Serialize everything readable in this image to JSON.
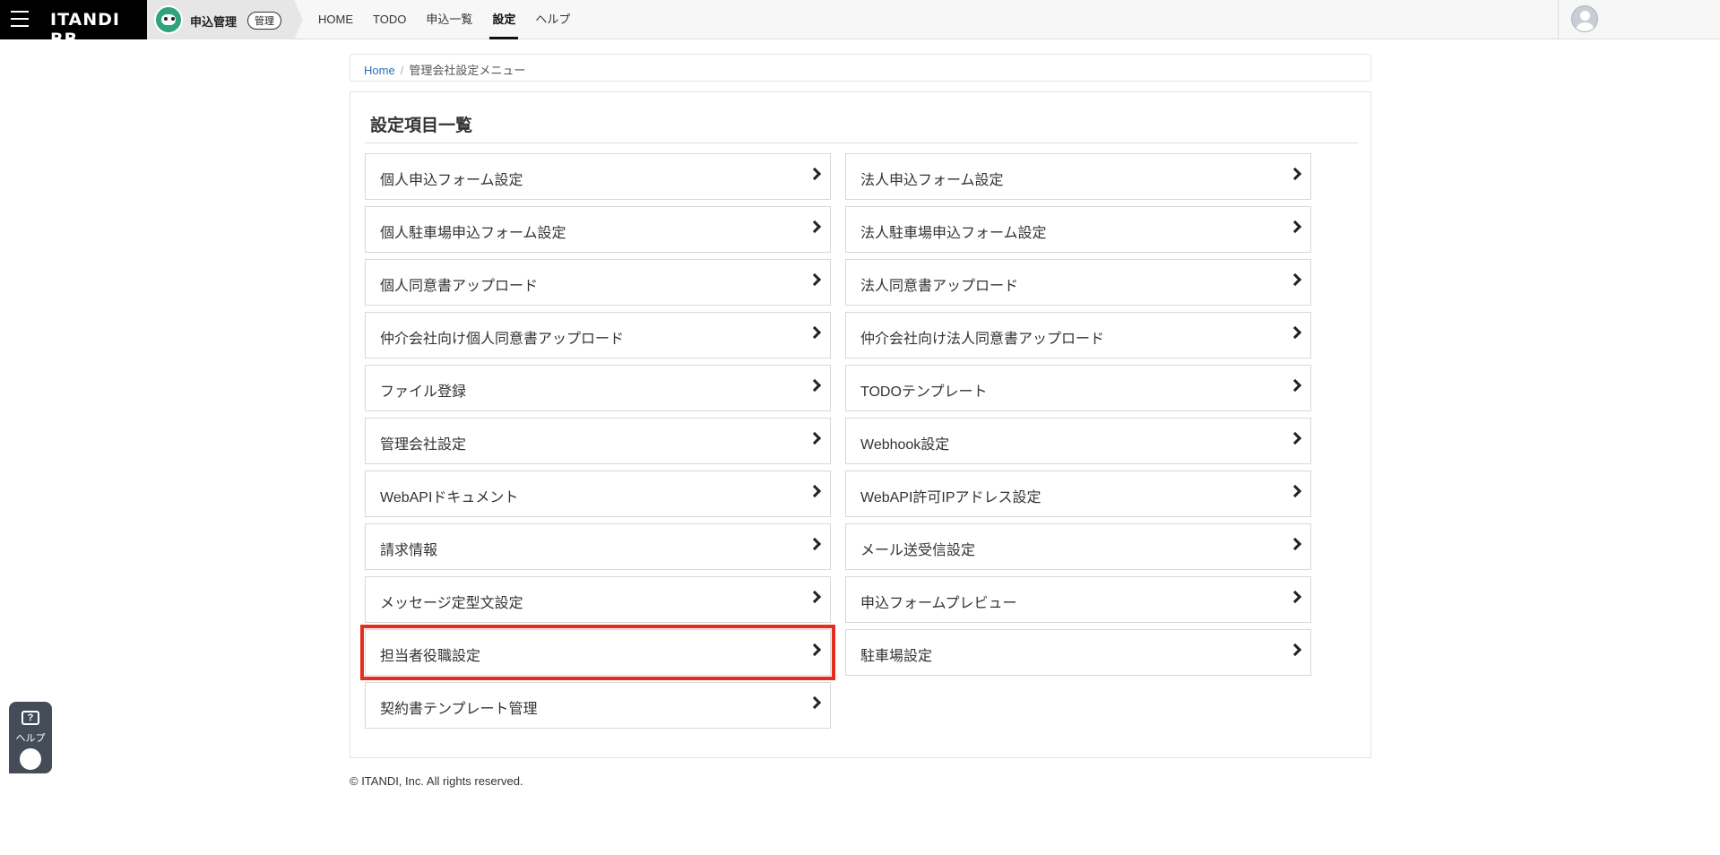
{
  "brand": {
    "name": "ITANDI BB"
  },
  "app": {
    "name": "申込管理",
    "badge": "管理"
  },
  "nav": {
    "items": [
      "HOME",
      "TODO",
      "申込一覧",
      "設定",
      "ヘルプ"
    ],
    "active": "設定"
  },
  "breadcrumb": {
    "home": "Home",
    "separator": "/",
    "current": "管理会社設定メニュー"
  },
  "panel": {
    "title": "設定項目一覧",
    "items": [
      "個人申込フォーム設定",
      "法人申込フォーム設定",
      "個人駐車場申込フォーム設定",
      "法人駐車場申込フォーム設定",
      "個人同意書アップロード",
      "法人同意書アップロード",
      "仲介会社向け個人同意書アップロード",
      "仲介会社向け法人同意書アップロード",
      "ファイル登録",
      "TODOテンプレート",
      "管理会社設定",
      "Webhook設定",
      "WebAPIドキュメント",
      "WebAPI許可IPアドレス設定",
      "請求情報",
      "メール送受信設定",
      "メッセージ定型文設定",
      "申込フォームプレビュー",
      "担当者役職設定",
      "駐車場設定",
      "契約書テンプレート管理"
    ],
    "highlighted_item": "担当者役職設定"
  },
  "footer": {
    "copyright": "© ITANDI, Inc. All rights reserved."
  },
  "help": {
    "label": "ヘルプ",
    "icon_glyph": "?"
  },
  "colors": {
    "highlight": "#e52d1f",
    "link": "#2a6db5",
    "brand_bg": "#000000"
  }
}
